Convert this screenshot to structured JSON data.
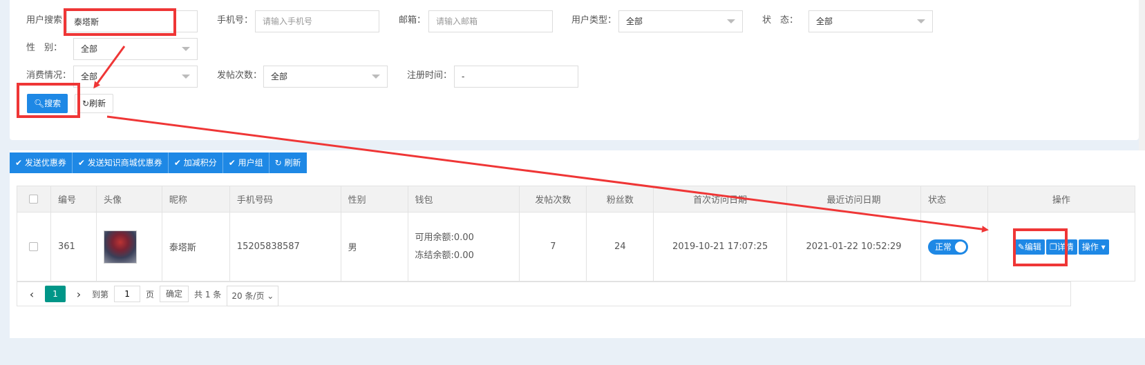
{
  "search": {
    "user_label": "用户搜索",
    "user_value": "泰塔斯",
    "phone_label": "手机号：",
    "phone_placeholder": "请输入手机号",
    "email_label": "邮箱：",
    "email_placeholder": "请输入邮箱",
    "usertype_label": "用户类型：",
    "usertype_value": "全部",
    "status_label": "状　态：",
    "status_value": "全部",
    "gender_label": "性　别：",
    "gender_value": "全部",
    "consume_label": "消费情况：",
    "consume_value": "全部",
    "posts_label": "发帖次数：",
    "posts_value": "全部",
    "regtime_label": "注册时间：",
    "regtime_value": "-",
    "search_button": "搜索",
    "refresh_button": "刷新"
  },
  "toolbar": {
    "buttons": [
      "发送优惠券",
      "发送知识商城优惠券",
      "加减积分",
      "用户组",
      "刷新"
    ]
  },
  "table": {
    "headers": [
      "编号",
      "头像",
      "昵称",
      "手机号码",
      "性别",
      "钱包",
      "发帖次数",
      "粉丝数",
      "首次访问日期",
      "最近访问日期",
      "状态",
      "操作"
    ],
    "rows": [
      {
        "id": "361",
        "nickname": "泰塔斯",
        "phone": "15205838587",
        "gender": "男",
        "wallet_available": "可用余额:0.00",
        "wallet_frozen": "冻结余额:0.00",
        "posts": "7",
        "fans": "24",
        "first_visit": "2019-10-21 17:07:25",
        "last_visit": "2021-01-22 10:52:29",
        "status": "正常",
        "edit": "编辑",
        "detail": "详情",
        "action": "操作"
      }
    ]
  },
  "pager": {
    "current": "1",
    "goto_label": "到第",
    "page_input": "1",
    "page_unit": "页",
    "confirm": "确定",
    "total": "共 1 条",
    "page_size": "20 条/页"
  },
  "colors": {
    "primary": "#1e88e5",
    "pager_active": "#009688",
    "annotation": "#ef3636"
  }
}
